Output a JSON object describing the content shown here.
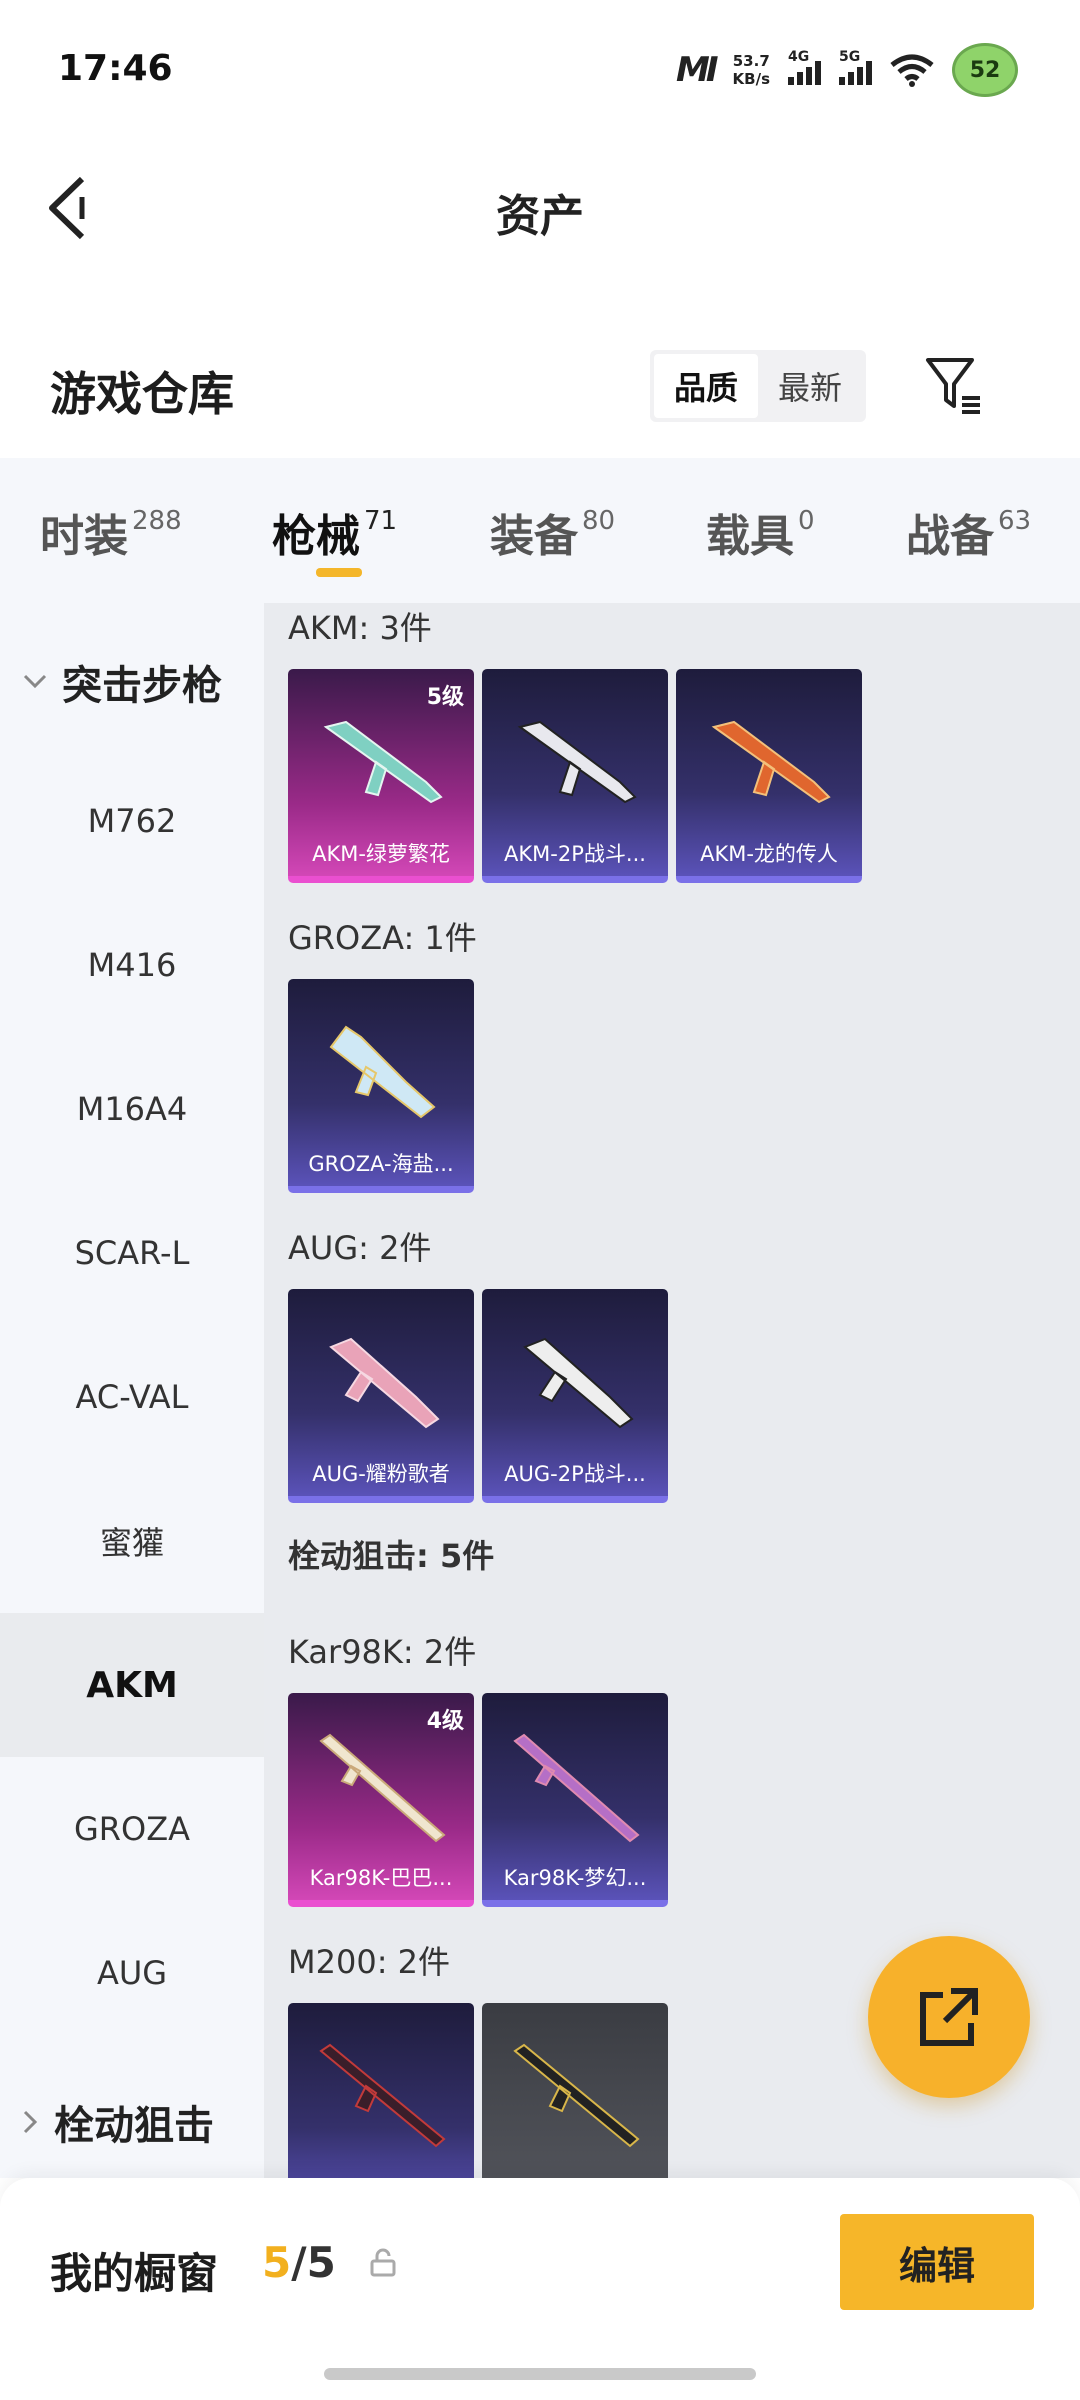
{
  "status": {
    "time": "17:46",
    "speed_value": "53.7",
    "speed_unit": "KB/s",
    "net_badge": "MI",
    "sig1_label": "4G",
    "sig2_label": "5G",
    "battery": "52"
  },
  "header": {
    "title": "资产"
  },
  "warehouse": {
    "title": "游戏仓库",
    "sort_quality": "品质",
    "sort_newest": "最新"
  },
  "tabs": [
    {
      "label": "时装",
      "count": "288"
    },
    {
      "label": "枪械",
      "count": "71"
    },
    {
      "label": "装备",
      "count": "80"
    },
    {
      "label": "载具",
      "count": "0"
    },
    {
      "label": "战备",
      "count": "63"
    }
  ],
  "sidebar": {
    "cat_assault": "突击步枪",
    "cat_bolt": "栓动狙击",
    "items": [
      "M762",
      "M416",
      "M16A4",
      "SCAR-L",
      "AC-VAL",
      "蜜獾",
      "AKM",
      "GROZA",
      "AUG"
    ]
  },
  "groups": {
    "akm": "AKM: 3件",
    "groza": "GROZA: 1件",
    "aug": "AUG: 2件",
    "bolt": "栓动狙击: 5件",
    "kar98k": "Kar98K: 2件",
    "m200": "M200: 2件"
  },
  "cards": {
    "akm_1": {
      "name": "AKM-绿萝繁花",
      "level": "5级"
    },
    "akm_2": {
      "name": "AKM-2P战斗..."
    },
    "akm_3": {
      "name": "AKM-龙的传人"
    },
    "groza_1": {
      "name": "GROZA-海盐..."
    },
    "aug_1": {
      "name": "AUG-耀粉歌者"
    },
    "aug_2": {
      "name": "AUG-2P战斗..."
    },
    "kar_1": {
      "name": "Kar98K-巴巴...",
      "level": "4级"
    },
    "kar_2": {
      "name": "Kar98K-梦幻..."
    }
  },
  "bottom": {
    "window_label": "我的橱窗",
    "window_current": "5",
    "window_total": "/5",
    "edit_label": "编辑"
  },
  "colors": {
    "accent": "#f6b629",
    "legendary": "#d247b6",
    "epic": "#5a52b8"
  }
}
